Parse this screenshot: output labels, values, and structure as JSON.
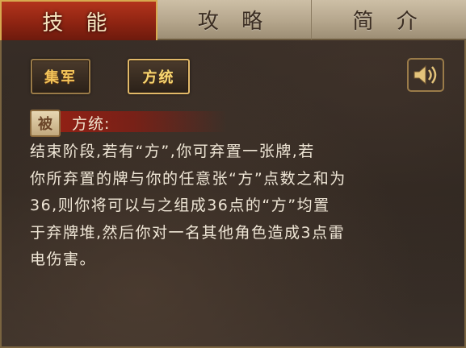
{
  "tabs": [
    {
      "label": "技 能",
      "active": true
    },
    {
      "label": "攻 略",
      "active": false
    },
    {
      "label": "简 介",
      "active": false
    }
  ],
  "skills": [
    {
      "label": "集军"
    },
    {
      "label": "方统"
    }
  ],
  "passive_badge": "被",
  "skill_title": "方统:",
  "description_lines": [
    "结束阶段,若有“方”,你可弃置一张牌,若",
    "你所弃置的牌与你的任意张“方”点数之和为",
    "36,则你将可以与之组成36点的“方”均置",
    "于弃牌堆,然后你对一名其他角色造成3点雷",
    "电伤害。"
  ],
  "icons": {
    "sound": "speaker-icon"
  },
  "colors": {
    "active_tab": "#a12a16",
    "skill_text": "#f2c45a",
    "panel": "#2e2620"
  }
}
